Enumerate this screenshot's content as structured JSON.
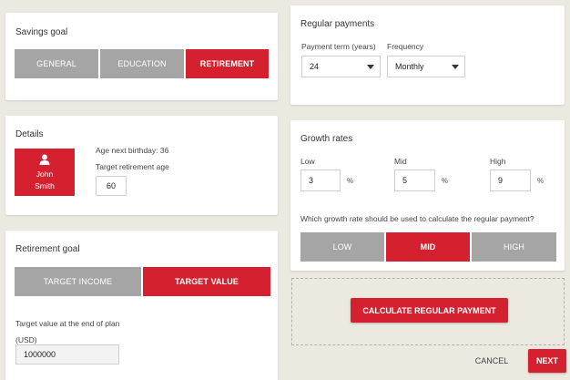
{
  "savings_goal": {
    "title": "Savings goal",
    "options": [
      "GENERAL",
      "EDUCATION",
      "RETIREMENT"
    ],
    "selected": "RETIREMENT"
  },
  "details": {
    "title": "Details",
    "avatar_name_first": "John",
    "avatar_name_last": "Smith",
    "age_label": "Age next birthday: 36",
    "target_age_label": "Target retirement age",
    "target_age_value": "60"
  },
  "retirement_goal": {
    "title": "Retirement goal",
    "options": [
      "TARGET INCOME",
      "TARGET VALUE"
    ],
    "selected": "TARGET VALUE",
    "target_value_label": "Target value at the end of plan",
    "currency_label": "(USD)",
    "target_value": "1000000"
  },
  "regular_payments": {
    "title": "Regular payments",
    "term_label": "Payment term (years)",
    "term_value": "24",
    "frequency_label": "Frequency",
    "frequency_value": "Monthly"
  },
  "growth_rates": {
    "title": "Growth rates",
    "low_label": "Low",
    "low_value": "3",
    "mid_label": "Mid",
    "mid_value": "5",
    "high_label": "High",
    "high_value": "9",
    "percent": "%",
    "question": "Which growth rate should be used to calculate the regular payment?",
    "options": [
      "LOW",
      "MID",
      "HIGH"
    ],
    "selected": "MID"
  },
  "actions": {
    "calculate_label": "CALCULATE REGULAR PAYMENT",
    "cancel_label": "CANCEL",
    "next_label": "NEXT"
  },
  "colors": {
    "accent": "#d4202f",
    "inactive": "#a5a5a5",
    "background": "#ece9e1"
  }
}
